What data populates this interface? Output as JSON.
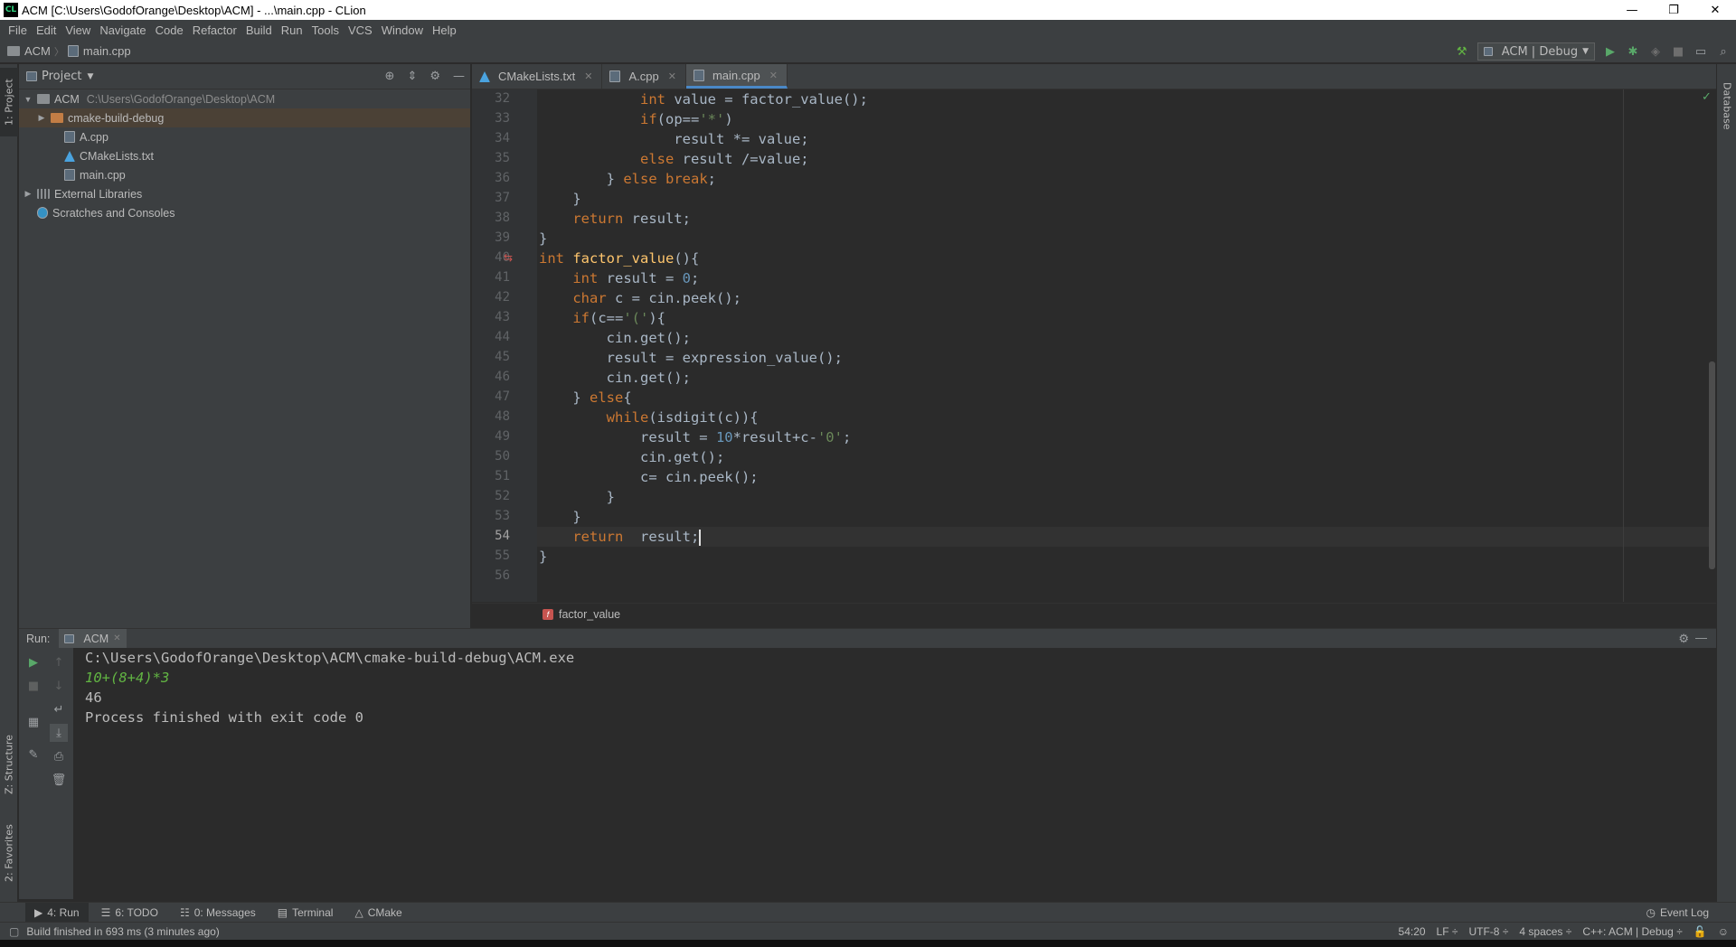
{
  "window": {
    "app_icon": "CL",
    "title": "ACM [C:\\Users\\GodofOrange\\Desktop\\ACM] - ...\\main.cpp - CLion",
    "controls": [
      "—",
      "❐",
      "✕"
    ]
  },
  "menu": [
    "File",
    "Edit",
    "View",
    "Navigate",
    "Code",
    "Refactor",
    "Build",
    "Run",
    "Tools",
    "VCS",
    "Window",
    "Help"
  ],
  "navbar": {
    "crumbs": [
      "ACM",
      "main.cpp"
    ],
    "separator": "〉",
    "run_config": "ACM | Debug"
  },
  "left_strip": {
    "project_tab": "1: Project",
    "structure_tab": "Z: Structure",
    "favorites_tab": "2: Favorites"
  },
  "right_strip": {
    "database_tab": "Database"
  },
  "project": {
    "title": "Project",
    "tree": [
      {
        "label": "ACM",
        "path": "C:\\Users\\GodofOrange\\Desktop\\ACM",
        "indent": 0,
        "expanded": true,
        "icon": "folder"
      },
      {
        "label": "cmake-build-debug",
        "indent": 1,
        "expanded": false,
        "icon": "folder-orange",
        "selected": true
      },
      {
        "label": "A.cpp",
        "indent": 2,
        "icon": "cpp-file"
      },
      {
        "label": "CMakeLists.txt",
        "indent": 2,
        "icon": "cmake-file"
      },
      {
        "label": "main.cpp",
        "indent": 2,
        "icon": "cpp-file"
      },
      {
        "label": "External Libraries",
        "indent": 0,
        "expanded": false,
        "icon": "libraries"
      },
      {
        "label": "Scratches and Consoles",
        "indent": 0,
        "icon": "scratches"
      }
    ]
  },
  "editor": {
    "tabs": [
      {
        "label": "CMakeLists.txt",
        "icon": "cmake-file",
        "active": false
      },
      {
        "label": "A.cpp",
        "icon": "cpp-file",
        "active": false
      },
      {
        "label": "main.cpp",
        "icon": "cpp-file",
        "active": true
      }
    ],
    "lines": [
      {
        "n": "32",
        "html": "            <span class='kw'>int</span> value = factor_value();"
      },
      {
        "n": "33",
        "html": "            <span class='kw'>if</span>(op==<span class='str'>'*'</span>)"
      },
      {
        "n": "34",
        "html": "                result *= value;"
      },
      {
        "n": "35",
        "html": "            <span class='kw'>else</span> result /=value;"
      },
      {
        "n": "36",
        "html": "        } <span class='kw'>else break</span>;"
      },
      {
        "n": "37",
        "html": "    }"
      },
      {
        "n": "38",
        "html": "    <span class='kw'>return</span> result;"
      },
      {
        "n": "39",
        "html": "}"
      },
      {
        "n": "40",
        "html": "<span class='kw'>int</span> <span class='fn'>factor_value</span>(){"
      },
      {
        "n": "41",
        "html": "    <span class='kw'>int</span> result = <span class='num'>0</span>;"
      },
      {
        "n": "42",
        "html": "    <span class='kw'>char</span> c = cin.peek();"
      },
      {
        "n": "43",
        "html": "    <span class='kw'>if</span>(c==<span class='str'>'('</span>){"
      },
      {
        "n": "44",
        "html": "        cin.get();"
      },
      {
        "n": "45",
        "html": "        result = expression_value();"
      },
      {
        "n": "46",
        "html": "        cin.get();"
      },
      {
        "n": "47",
        "html": "    } <span class='kw'>else</span>{"
      },
      {
        "n": "48",
        "html": "        <span class='kw'>while</span>(isdigit(c)){"
      },
      {
        "n": "49",
        "html": "            result = <span class='num'>10</span>*result+c-<span class='str'>'0'</span>;"
      },
      {
        "n": "50",
        "html": "            cin.get();"
      },
      {
        "n": "51",
        "html": "            c= cin.peek();"
      },
      {
        "n": "52",
        "html": "        }"
      },
      {
        "n": "53",
        "html": "    }"
      },
      {
        "n": "54",
        "html": "    <span class='kw'>return</span>  result;<span class='caret'></span>",
        "current": true
      },
      {
        "n": "55",
        "html": "}"
      },
      {
        "n": "56",
        "html": ""
      }
    ],
    "breadcrumb": "factor_value",
    "breadcrumb_badge": "f"
  },
  "run": {
    "label": "Run:",
    "tab": "ACM",
    "console": [
      {
        "text": "C:\\Users\\GodofOrange\\Desktop\\ACM\\cmake-build-debug\\ACM.exe",
        "kind": "out"
      },
      {
        "text": "10+(8+4)*3",
        "kind": "input"
      },
      {
        "text": "46",
        "kind": "out"
      },
      {
        "text": "Process finished with exit code 0",
        "kind": "out"
      }
    ]
  },
  "bottom_tabs": [
    {
      "label": "4: Run",
      "icon": "▶",
      "active": true
    },
    {
      "label": "6: TODO",
      "icon": "☰",
      "active": false
    },
    {
      "label": "0: Messages",
      "icon": "☷",
      "active": false
    },
    {
      "label": "Terminal",
      "icon": "▤",
      "active": false
    },
    {
      "label": "CMake",
      "icon": "△",
      "active": false
    }
  ],
  "event_log": "Event Log",
  "status": {
    "message": "Build finished in 693 ms (3 minutes ago)",
    "position": "54:20",
    "line_sep": "LF ÷",
    "encoding": "UTF-8 ÷",
    "indent": "4 spaces ÷",
    "context": "C++: ACM | Debug ÷"
  }
}
